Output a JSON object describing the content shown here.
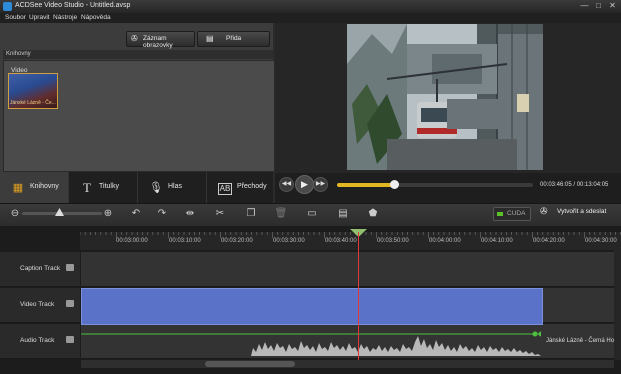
{
  "window": {
    "title": "ACDSee Video Studio - Untitled.avsp",
    "controls": [
      "—",
      "□",
      "✕"
    ]
  },
  "menu": [
    "Soubor",
    "Upravit",
    "Nástroje",
    "Nápověda"
  ],
  "library": {
    "record_button": "Záznam obrazovky",
    "add_button": "Přida",
    "header": "Knihovny",
    "section_label": "Video",
    "media_items": [
      {
        "name": "Jánské Lázně - Če..."
      }
    ]
  },
  "tabs": [
    {
      "label": "Knihovny",
      "icon": "library-icon",
      "active": true
    },
    {
      "label": "Titulky",
      "icon": "titles-icon",
      "active": false
    },
    {
      "label": "Hlas",
      "icon": "microphone-icon",
      "active": false
    },
    {
      "label": "Přechody",
      "icon": "transitions-icon",
      "active": false
    }
  ],
  "playback": {
    "current_time": "00:03:46:05",
    "total_time": "00:13:04:05",
    "time_display": "00:03:46:05 / 00:13:04:05",
    "progress": 0.29
  },
  "toolbar": {
    "zoom_level": 0.45,
    "cuda_label": "CUDA",
    "export_label": "Vytvořit a sdeslat"
  },
  "timeline": {
    "ruler_labels": [
      "00:03:00:00",
      "00:03:10:00",
      "00:03:20:00",
      "00:03:30:00",
      "00:03:40:00",
      "00:03:50:00",
      "00:04:00:00",
      "00:04:10:00",
      "00:04:20:00",
      "00:04:30:00"
    ],
    "tracks": [
      {
        "name": "Caption Track"
      },
      {
        "name": "Video Track"
      },
      {
        "name": "Audio Track"
      }
    ],
    "audio_clip_label": "Jánské Lázně - Černá Ho"
  },
  "colors": {
    "accent": "#e1b822",
    "video_clip": "#5a72c8",
    "playhead": "#e0383f",
    "cuda_led": "#5cc02a"
  }
}
